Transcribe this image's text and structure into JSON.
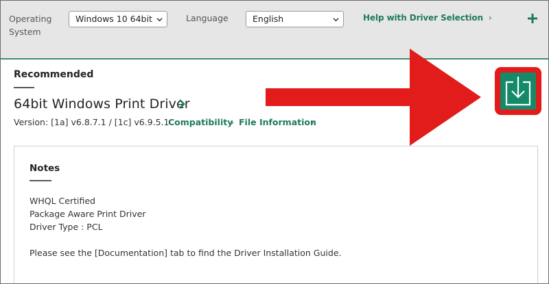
{
  "filters": {
    "os_label": "Operating System",
    "os_value": "Windows 10 64bit",
    "language_label": "Language",
    "language_value": "English",
    "help_link": "Help with Driver Selection",
    "chevron": "›",
    "expand_icon": "plus-icon"
  },
  "recommended": {
    "heading": "Recommended",
    "driver_name": "64bit Windows Print Driver",
    "version": "Version: [1a] v6.8.7.1 / [1c] v6.9.5.1",
    "compatibility_link": "Compatibility",
    "file_info_link": "File Information",
    "download_icon": "download-icon"
  },
  "notes": {
    "heading": "Notes",
    "lines": [
      "WHQL Certified",
      "Package Aware Print Driver",
      "Driver Type : PCL",
      "Please see the [Documentation] tab to find the Driver Installation Guide."
    ]
  },
  "colors": {
    "accent_green": "#1f7a5c",
    "button_green": "#148a69",
    "annotation_red": "#e21b1b",
    "topbar_gray": "#e6e6e6"
  }
}
